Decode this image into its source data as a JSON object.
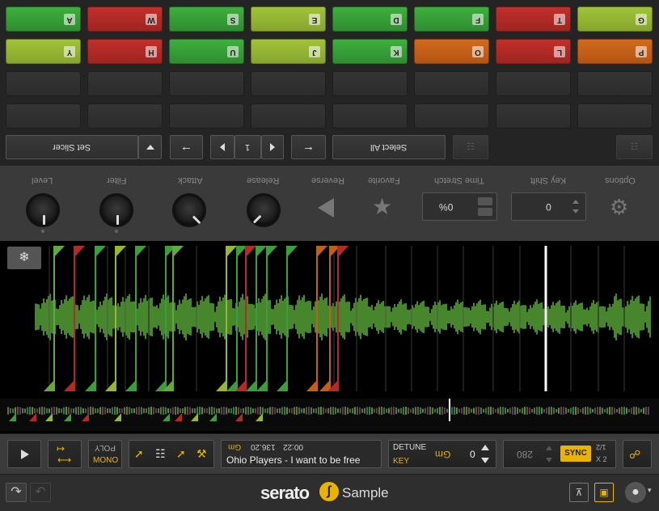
{
  "pads": {
    "row1": [
      {
        "key": "A",
        "color": "green"
      },
      {
        "key": "W",
        "color": "red"
      },
      {
        "key": "S",
        "color": "green"
      },
      {
        "key": "E",
        "color": "yellow"
      },
      {
        "key": "D",
        "color": "green"
      },
      {
        "key": "F",
        "color": "green"
      },
      {
        "key": "T",
        "color": "red"
      },
      {
        "key": "G",
        "color": "yellow"
      }
    ],
    "row2": [
      {
        "key": "Y",
        "color": "yellow"
      },
      {
        "key": "H",
        "color": "red"
      },
      {
        "key": "U",
        "color": "green"
      },
      {
        "key": "J",
        "color": "yellow"
      },
      {
        "key": "K",
        "color": "green"
      },
      {
        "key": "O",
        "color": "orange"
      },
      {
        "key": "L",
        "color": "red"
      },
      {
        "key": "P",
        "color": "orange"
      }
    ]
  },
  "controls": {
    "set_slicer_label": "Set Slicer",
    "bank_value": "1",
    "select_all_label": "Select All"
  },
  "knob_row": {
    "level": "Level",
    "filter": "Filter",
    "attack": "Attack",
    "release": "Release",
    "reverse": "Reverse",
    "favorite": "Favorite",
    "time_stretch": "Time Stretch",
    "time_stretch_value": "0%",
    "key_shift": "Key Shift",
    "key_shift_value": "0",
    "options": "Options"
  },
  "deck": {
    "poly": "POLY",
    "mono": "MONO",
    "track_key": "Gm",
    "bpm": "136.20",
    "length": "00:22",
    "track_title": "Ohio Players - I want to be free",
    "detune": "DETUNE",
    "key_label": "KEY",
    "key_value": "Gm",
    "detune_value": "0",
    "tempo_value": "280",
    "sync": "SYNC",
    "half": "1/2",
    "double": "X 2"
  },
  "footer": {
    "brand": "serato",
    "product": "Sample"
  },
  "colors": {
    "green": "#3a9f3a",
    "red": "#b32a26",
    "yellow": "#97b634",
    "orange": "#c45f18",
    "accent": "#e8b400"
  }
}
